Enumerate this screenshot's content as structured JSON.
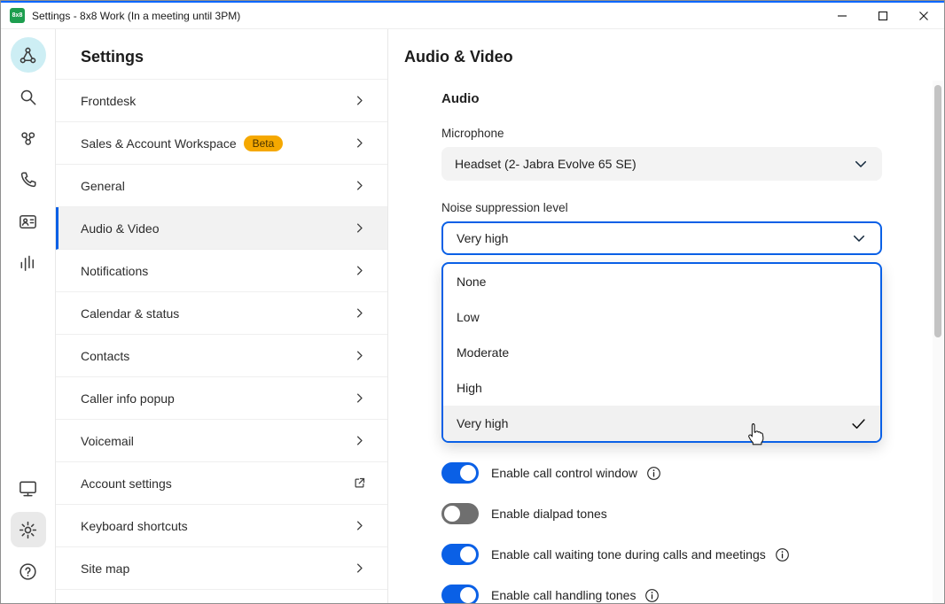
{
  "window": {
    "title": "Settings - 8x8 Work (In a meeting until 3PM)",
    "logo_text": "8x8",
    "controls": {
      "minimize": "minimize",
      "maximize": "maximize",
      "close": "close"
    }
  },
  "colors": {
    "accent": "#0a60e6",
    "badge_bg": "#f5a800",
    "logo_bg": "#1d9e4f",
    "toggle_off": "#6f6f6f",
    "selected_item_bg": "#f2f2f2"
  },
  "rail": {
    "items": [
      {
        "icon": "workspace-icon",
        "active": true
      },
      {
        "icon": "search-icon"
      },
      {
        "icon": "people-icon"
      },
      {
        "icon": "phone-icon"
      },
      {
        "icon": "contact-card-icon"
      },
      {
        "icon": "equalizer-icon"
      },
      {
        "icon": "monitor-icon"
      },
      {
        "icon": "settings-gear-icon",
        "active": true
      },
      {
        "icon": "help-icon"
      }
    ]
  },
  "nav": {
    "title": "Settings",
    "items": [
      {
        "label": "Frontdesk"
      },
      {
        "label": "Sales & Account Workspace",
        "badge": "Beta"
      },
      {
        "label": "General"
      },
      {
        "label": "Audio & Video",
        "selected": true
      },
      {
        "label": "Notifications"
      },
      {
        "label": "Calendar & status"
      },
      {
        "label": "Contacts"
      },
      {
        "label": "Caller info popup"
      },
      {
        "label": "Voicemail"
      },
      {
        "label": "Account settings",
        "external": true
      },
      {
        "label": "Keyboard shortcuts"
      },
      {
        "label": "Site map"
      }
    ]
  },
  "content": {
    "title": "Audio & Video",
    "section": "Audio",
    "microphone": {
      "label": "Microphone",
      "value": "Headset (2- Jabra Evolve 65 SE)"
    },
    "noise": {
      "label": "Noise suppression level",
      "value": "Very high",
      "options": [
        "None",
        "Low",
        "Moderate",
        "High",
        "Very high"
      ],
      "selected": "Very high"
    },
    "toggles": [
      {
        "label": "Enable call control window",
        "on": true,
        "info": true
      },
      {
        "label": "Enable dialpad tones",
        "on": false,
        "info": false
      },
      {
        "label": "Enable call waiting tone during calls and meetings",
        "on": true,
        "info": true
      },
      {
        "label": "Enable call handling tones",
        "on": true,
        "info": true
      }
    ]
  }
}
